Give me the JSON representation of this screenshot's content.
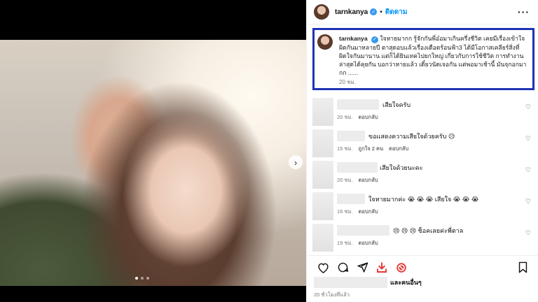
{
  "header": {
    "username": "tarnkanya",
    "separator": "•",
    "follow_label": "ติดตาม",
    "more_icon": "more-icon"
  },
  "caption": {
    "username": "tarnkanya",
    "text": "ใจหายมากก รู้จักกันพี่อ๋อมาเกินครึ่งชีวิต เคยมีเรื่องเข้าใจผิดกันมาหลายปี ตาสุดอบแล้วเรื่องเดือดร้อนฟ้า3 ได้มีโอกาสเคลียร์สิ่งที่ผิดใจกันมานาน แต่ก็ได้ยินเทคไปยกใหญ่ เกี่ยวกับการใช้ชีวิต การทำงาน ล่าสุดได้คุยกัน บอกว่าหายแล้ว เดี๋ยวนัดเจอกัน แต่พอมาเช้านี้ มันจุกอกมากก ......",
    "time": "20 ชม."
  },
  "comments": [
    {
      "text": "เสียใจครับ",
      "time": "20 ชม.",
      "likes": "",
      "reply": "ตอบกลับ"
    },
    {
      "text": "ขอแสดงความเสียใจด้วยครับ 😥",
      "time": "15 ชม.",
      "likes": "ถูกใจ 2 คน",
      "reply": "ตอบกลับ"
    },
    {
      "text": "เสียใจด้วยนะคะ",
      "time": "20 ชม.",
      "likes": "",
      "reply": "ตอบกลับ"
    },
    {
      "text": "ใจหายมากค่ะ 😭 😭 😭 เสียใจ 😭 😭 😭",
      "time": "16 ชม.",
      "likes": "",
      "reply": "ตอบกลับ"
    },
    {
      "text": "😢 😢 😢 ช็อคเลยค่ะพี่ตาล",
      "time": "19 ชม.",
      "likes": "",
      "reply": "ตอบกลับ"
    }
  ],
  "actions": {
    "like_icon": "heart-icon",
    "comment_icon": "comment-icon",
    "share_icon": "share-icon",
    "download_icon": "download-icon",
    "block_icon": "block-icon",
    "save_icon": "bookmark-icon"
  },
  "likes_text": "และคนอื่นๆ",
  "post_time": "20 ชั่วโมงที่แล้ว",
  "media": {
    "slide_count": 3,
    "active_slide": 1
  },
  "colors": {
    "accent": "#0095f6",
    "highlight_border": "#1f33b4",
    "verified": "#3797f0",
    "download_red": "#e53935"
  }
}
